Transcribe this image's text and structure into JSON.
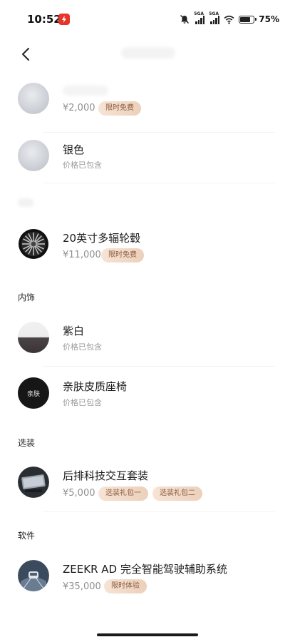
{
  "status_bar": {
    "time": "10:52",
    "signal1_tag": "5GA",
    "signal2_tag": "5GA",
    "battery_text": "75%",
    "battery_level": 0.75
  },
  "nav": {
    "back_icon": "chevron-left-icon"
  },
  "items": {
    "paint_1": {
      "price": "¥2,000",
      "badge": "限时免费"
    },
    "paint_2": {
      "name": "银色",
      "sub": "价格已包含"
    },
    "wheel": {
      "name": "20英寸多辐轮毂",
      "price": "¥11,000",
      "badge": "限时免费"
    },
    "interior_1": {
      "name": "紫白",
      "sub": "价格已包含"
    },
    "interior_2": {
      "name": "亲肤皮质座椅",
      "sub": "价格已包含",
      "thumb_text": "亲肤"
    },
    "option_1": {
      "name": "后排科技交互套装",
      "price": "¥5,000",
      "badge1": "选装礼包一",
      "badge2": "选装礼包二"
    },
    "software_1": {
      "name": "ZEEKR AD 完全智能驾驶辅助系统",
      "price": "¥35,000",
      "badge": "限时体验"
    }
  },
  "sections": {
    "interior": "内饰",
    "options": "选装",
    "software": "软件"
  },
  "colors": {
    "badge_text": "#8a5a3c",
    "badge_bg_start": "#f6e4d6",
    "badge_bg_end": "#ecd0bb",
    "status_app": "#e8352a"
  }
}
